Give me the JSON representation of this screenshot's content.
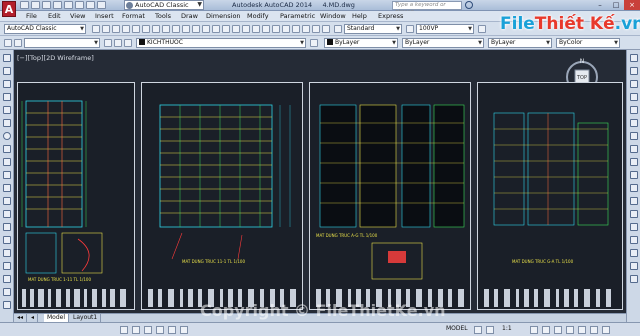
{
  "window": {
    "title": "Autodesk AutoCAD 2014",
    "filename": "4.MD.dwg",
    "workspace": "AutoCAD Classic",
    "search_placeholder": "Type a keyword or phrase"
  },
  "menu": [
    "File",
    "Edit",
    "View",
    "Insert",
    "Format",
    "Tools",
    "Draw",
    "Dimension",
    "Modify",
    "Parametric",
    "Window",
    "Help",
    "Express"
  ],
  "toolbar": {
    "workspace_combo": "AutoCAD Classic",
    "text_style": "Standard",
    "dim_style": "100VP",
    "layer": "KICHTHUOC",
    "color": "ByLayer",
    "linetype": "ByLayer",
    "lineweight": "ByLayer",
    "plot_style": "ByColor"
  },
  "viewport": {
    "label": "[−][Top][2D Wireframe]",
    "compass_n": "N",
    "compass_s": "S",
    "compass_w": "W",
    "compass_e": "E",
    "cube_label": "TOP"
  },
  "sheets": [
    {
      "caption": "MAT DUNG TRUC 1-11 TL 1/100"
    },
    {
      "caption": "MAT DUNG TRUC 11-1 TL 1/100"
    },
    {
      "caption": "MAT DUNG TRUC A-G TL 1/100"
    },
    {
      "caption": "MAT DUNG TRUC G-A TL 1/100"
    }
  ],
  "tabs": [
    "Model",
    "Layout1"
  ],
  "status": {
    "coords": "",
    "model_label": "MODEL",
    "scale": "1:1"
  },
  "brand": {
    "part1": "File",
    "part2": "Thiết Kế",
    "part3": ".vn"
  },
  "copyright": "Copyright © FileThietKe.vn",
  "colors": {
    "canvas": "#252b36",
    "sheet_border": "#cfd6e0",
    "accent": "#1aa1d8",
    "brand_red": "#e8392c"
  }
}
